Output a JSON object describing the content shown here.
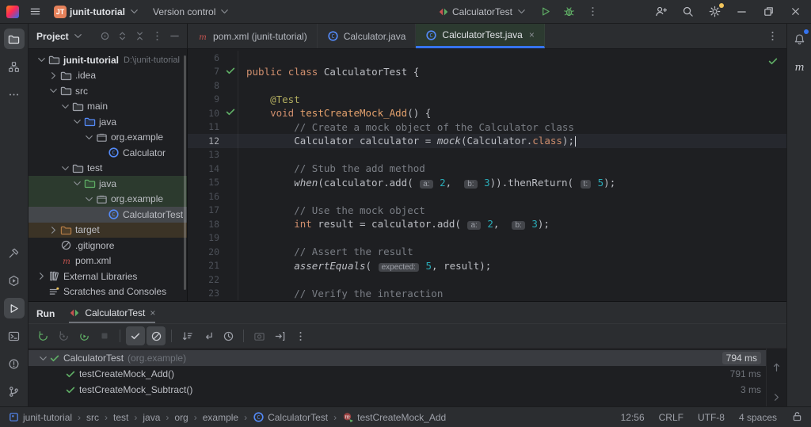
{
  "titlebar": {
    "project_badge": "JT",
    "project_name": "junit-tutorial",
    "vcs_label": "Version control",
    "run_config": "CalculatorTest",
    "window_buttons": [
      "minimize",
      "restore",
      "close"
    ]
  },
  "tab_bar": {
    "tabs": [
      {
        "label": "pom.xml (junit-tutorial)",
        "icon": "maven",
        "active": false,
        "closable": false
      },
      {
        "label": "Calculator.java",
        "icon": "class",
        "active": false,
        "closable": false
      },
      {
        "label": "CalculatorTest.java",
        "icon": "class",
        "active": true,
        "closable": true
      }
    ]
  },
  "project_panel": {
    "title": "Project",
    "toolbar_icons": [
      "locate",
      "expand-all",
      "collapse-all",
      "more-vert",
      "hide-panel"
    ],
    "tree": [
      {
        "label": "junit-tutorial",
        "suffix": "D:\\junit-tutorial",
        "icon": "folder-project",
        "depth": 0,
        "chevron": "open",
        "bold": true
      },
      {
        "label": ".idea",
        "icon": "folder",
        "depth": 1,
        "chevron": "closed"
      },
      {
        "label": "src",
        "icon": "folder",
        "depth": 1,
        "chevron": "open"
      },
      {
        "label": "main",
        "icon": "folder",
        "depth": 2,
        "chevron": "open"
      },
      {
        "label": "java",
        "icon": "folder-src",
        "depth": 3,
        "chevron": "open"
      },
      {
        "label": "org.example",
        "icon": "package",
        "depth": 4,
        "chevron": "open"
      },
      {
        "label": "Calculator",
        "icon": "class",
        "depth": 5,
        "chevron": "none"
      },
      {
        "label": "test",
        "icon": "folder",
        "depth": 2,
        "chevron": "open"
      },
      {
        "label": "java",
        "icon": "folder-test",
        "depth": 3,
        "chevron": "open",
        "highlight": "test"
      },
      {
        "label": "org.example",
        "icon": "package",
        "depth": 4,
        "chevron": "open",
        "highlight": "test"
      },
      {
        "label": "CalculatorTest",
        "icon": "class",
        "depth": 5,
        "chevron": "none",
        "highlight": "selected"
      },
      {
        "label": "target",
        "icon": "folder-excluded",
        "depth": 1,
        "chevron": "closed",
        "highlight": "excluded"
      },
      {
        "label": ".gitignore",
        "icon": "ignored",
        "depth": 1,
        "chevron": "none"
      },
      {
        "label": "pom.xml",
        "icon": "maven",
        "depth": 1,
        "chevron": "none"
      },
      {
        "label": "External Libraries",
        "icon": "libraries",
        "depth": 0,
        "chevron": "closed"
      },
      {
        "label": "Scratches and Consoles",
        "icon": "scratches",
        "depth": 0,
        "chevron": "none"
      }
    ]
  },
  "editor": {
    "caret_line": 12,
    "test_pass_lines": [
      7,
      10
    ],
    "lines": [
      {
        "n": 6,
        "tokens": []
      },
      {
        "n": 7,
        "tokens": [
          [
            "kw",
            "public"
          ],
          [
            "pl",
            " "
          ],
          [
            "kw",
            "class"
          ],
          [
            "pl",
            " "
          ],
          [
            "cls",
            "CalculatorTest"
          ],
          [
            "pl",
            " {"
          ]
        ]
      },
      {
        "n": 8,
        "tokens": []
      },
      {
        "n": 9,
        "tokens": [
          [
            "pl",
            "    "
          ],
          [
            "ann",
            "@Test"
          ]
        ]
      },
      {
        "n": 10,
        "tokens": [
          [
            "pl",
            "    "
          ],
          [
            "kw",
            "void"
          ],
          [
            "pl",
            " "
          ],
          [
            "meth",
            "testCreateMock_Add"
          ],
          [
            "pl",
            "() {"
          ]
        ]
      },
      {
        "n": 11,
        "tokens": [
          [
            "pl",
            "        "
          ],
          [
            "cmt",
            "// Create a mock object of the Calculator class"
          ]
        ]
      },
      {
        "n": 12,
        "tokens": [
          [
            "pl",
            "        "
          ],
          [
            "cls",
            "Calculator"
          ],
          [
            "pl",
            " calculator = "
          ],
          [
            "it",
            "mock"
          ],
          [
            "pl",
            "("
          ],
          [
            "cls",
            "Calculator"
          ],
          [
            "pl",
            "."
          ],
          [
            "kw",
            "class"
          ],
          [
            "pl",
            ");"
          ]
        ]
      },
      {
        "n": 13,
        "tokens": []
      },
      {
        "n": 14,
        "tokens": [
          [
            "pl",
            "        "
          ],
          [
            "cmt",
            "// Stub the add method"
          ]
        ]
      },
      {
        "n": 15,
        "tokens": [
          [
            "pl",
            "        "
          ],
          [
            "it",
            "when"
          ],
          [
            "pl",
            "(calculator.add( "
          ],
          [
            "hint",
            "a:"
          ],
          [
            "pl",
            " "
          ],
          [
            "num",
            "2"
          ],
          [
            "pl",
            ",  "
          ],
          [
            "hint",
            "b:"
          ],
          [
            "pl",
            " "
          ],
          [
            "num",
            "3"
          ],
          [
            "pl",
            ")).thenReturn( "
          ],
          [
            "hint",
            "t:"
          ],
          [
            "pl",
            " "
          ],
          [
            "num",
            "5"
          ],
          [
            "pl",
            ");"
          ]
        ]
      },
      {
        "n": 16,
        "tokens": []
      },
      {
        "n": 17,
        "tokens": [
          [
            "pl",
            "        "
          ],
          [
            "cmt",
            "// Use the mock object"
          ]
        ]
      },
      {
        "n": 18,
        "tokens": [
          [
            "pl",
            "        "
          ],
          [
            "kw",
            "int"
          ],
          [
            "pl",
            " result = calculator.add( "
          ],
          [
            "hint",
            "a:"
          ],
          [
            "pl",
            " "
          ],
          [
            "num",
            "2"
          ],
          [
            "pl",
            ",  "
          ],
          [
            "hint",
            "b:"
          ],
          [
            "pl",
            " "
          ],
          [
            "num",
            "3"
          ],
          [
            "pl",
            ");"
          ]
        ]
      },
      {
        "n": 19,
        "tokens": []
      },
      {
        "n": 20,
        "tokens": [
          [
            "pl",
            "        "
          ],
          [
            "cmt",
            "// Assert the result"
          ]
        ]
      },
      {
        "n": 21,
        "tokens": [
          [
            "pl",
            "        "
          ],
          [
            "it",
            "assertEquals"
          ],
          [
            "pl",
            "( "
          ],
          [
            "hint",
            "expected:"
          ],
          [
            "pl",
            " "
          ],
          [
            "num",
            "5"
          ],
          [
            "pl",
            ", result);"
          ]
        ]
      },
      {
        "n": 22,
        "tokens": []
      },
      {
        "n": 23,
        "tokens": [
          [
            "pl",
            "        "
          ],
          [
            "cmt",
            "// Verify the interaction"
          ]
        ]
      }
    ]
  },
  "run_panel": {
    "title": "Run",
    "tab_label": "CalculatorTest",
    "toolbar": [
      {
        "name": "rerun",
        "state": "green"
      },
      {
        "name": "rerun-failed",
        "state": "disabled"
      },
      {
        "name": "toggle-auto-test",
        "state": "green"
      },
      {
        "name": "stop",
        "state": "disabled"
      },
      {
        "name": "divider"
      },
      {
        "name": "show-passed",
        "state": "toggled"
      },
      {
        "name": "show-ignored",
        "state": "toggled"
      },
      {
        "name": "divider"
      },
      {
        "name": "sort-by-duration",
        "state": "normal"
      },
      {
        "name": "collapse-tree",
        "state": "normal"
      },
      {
        "name": "test-history",
        "state": "normal"
      },
      {
        "name": "divider"
      },
      {
        "name": "screenshot",
        "state": "disabled"
      },
      {
        "name": "export-test-results",
        "state": "normal"
      },
      {
        "name": "more-vert",
        "state": "normal"
      }
    ],
    "results": [
      {
        "name": "CalculatorTest",
        "pkg": "(org.example)",
        "time": "794 ms",
        "depth": 0,
        "selected": true,
        "chevron": true
      },
      {
        "name": "testCreateMock_Add()",
        "time": "791 ms",
        "depth": 1
      },
      {
        "name": "testCreateMock_Subtract()",
        "time": "3 ms",
        "depth": 1
      }
    ]
  },
  "status_bar": {
    "breadcrumbs": [
      {
        "label": "junit-tutorial",
        "icon": "project-square"
      },
      {
        "label": "src"
      },
      {
        "label": "test"
      },
      {
        "label": "java"
      },
      {
        "label": "org"
      },
      {
        "label": "example"
      },
      {
        "label": "CalculatorTest",
        "icon": "class"
      },
      {
        "label": "testCreateMock_Add",
        "icon": "test-method"
      }
    ],
    "right": [
      "12:56",
      "CRLF",
      "UTF-8",
      "4 spaces"
    ],
    "lock": "unlocked"
  },
  "colors": {
    "accent": "#3574f0",
    "pass_green": "#5fad65",
    "junit_red": "#c75450",
    "warn_yellow": "#f2c55c"
  }
}
